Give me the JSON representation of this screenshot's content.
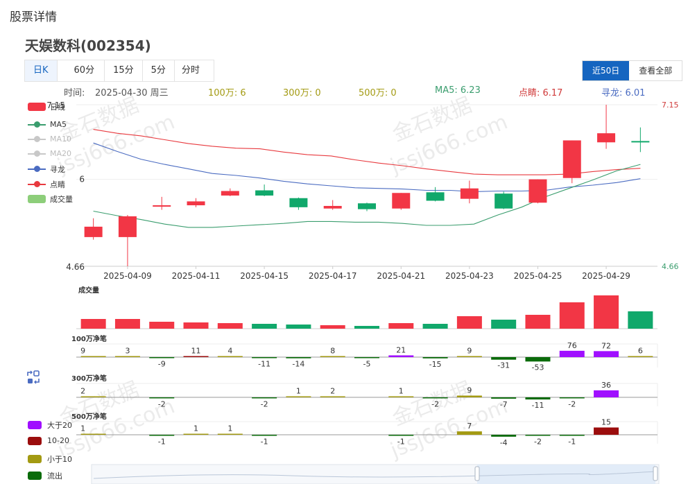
{
  "page_title": "股票详情",
  "stock_title": "天娱数科(002354)",
  "period_tabs": [
    "日K",
    "60分",
    "15分",
    "5分",
    "分时"
  ],
  "active_period": "日K",
  "range_tabs": [
    "近50日",
    "查看全部"
  ],
  "active_range": "近50日",
  "info": {
    "time_label": "时间:",
    "date": "2025-04-30 周三",
    "w100": "100万: 6",
    "w300": "300万: 0",
    "w500": "500万: 0",
    "ma5": "MA5: 6.23",
    "dianjing": "点睛: 6.17",
    "xunlong": "寻龙: 6.01"
  },
  "legend": [
    {
      "label": "日线",
      "type": "rect",
      "color": "#f23645"
    },
    {
      "label": "MA5",
      "type": "line",
      "color": "#3a9d6e"
    },
    {
      "label": "MA10",
      "type": "line",
      "color": "#c8c8c8"
    },
    {
      "label": "MA20",
      "type": "line",
      "color": "#c8c8c8"
    },
    {
      "label": "寻龙",
      "type": "line",
      "color": "#4a6bc1"
    },
    {
      "label": "点睛",
      "type": "line",
      "color": "#e8393e"
    },
    {
      "label": "成交量",
      "type": "rect",
      "color": "#8dce7a"
    }
  ],
  "flow_legend": [
    {
      "label": "大于20",
      "color": "#a00fff"
    },
    {
      "label": "10-20",
      "color": "#9b0d0d"
    },
    {
      "label": "小于10",
      "color": "#a39a12"
    },
    {
      "label": "流出",
      "color": "#0a6b0a"
    }
  ],
  "watermark": "金石数据 jssj666.com",
  "colors": {
    "up": "#f23645",
    "down": "#11a86b",
    "ma5": "#3a9d6e",
    "xunlong": "#4a6bc1",
    "dianjing": "#e8393e"
  },
  "chart_data": [
    {
      "type": "candlestick",
      "title": "",
      "ylim": [
        4.66,
        7.15
      ],
      "y_tick_labels": [
        "7.15",
        "6",
        "4.66"
      ],
      "right_tick_labels": [
        "7.15",
        "4.66"
      ],
      "x_tick_labels": [
        "2025-04-09",
        "2025-04-11",
        "2025-04-15",
        "2025-04-17",
        "2025-04-21",
        "2025-04-23",
        "2025-04-25",
        "2025-04-29"
      ],
      "candles": [
        {
          "open": 5.11,
          "close": 5.27,
          "high": 5.4,
          "low": 5.07,
          "dir": "up"
        },
        {
          "open": 5.11,
          "close": 5.43,
          "high": 5.45,
          "low": 4.66,
          "dir": "up"
        },
        {
          "open": 5.58,
          "close": 5.6,
          "high": 5.73,
          "low": 5.53,
          "dir": "up"
        },
        {
          "open": 5.6,
          "close": 5.66,
          "high": 5.71,
          "low": 5.57,
          "dir": "up"
        },
        {
          "open": 5.75,
          "close": 5.82,
          "high": 5.86,
          "low": 5.74,
          "dir": "up"
        },
        {
          "open": 5.83,
          "close": 5.75,
          "high": 5.92,
          "low": 5.74,
          "dir": "down"
        },
        {
          "open": 5.71,
          "close": 5.57,
          "high": 5.72,
          "low": 5.53,
          "dir": "down"
        },
        {
          "open": 5.55,
          "close": 5.59,
          "high": 5.68,
          "low": 5.53,
          "dir": "up"
        },
        {
          "open": 5.63,
          "close": 5.54,
          "high": 5.64,
          "low": 5.51,
          "dir": "down"
        },
        {
          "open": 5.55,
          "close": 5.79,
          "high": 5.79,
          "low": 5.53,
          "dir": "up"
        },
        {
          "open": 5.8,
          "close": 5.67,
          "high": 5.88,
          "low": 5.66,
          "dir": "down"
        },
        {
          "open": 5.7,
          "close": 5.86,
          "high": 5.98,
          "low": 5.63,
          "dir": "up"
        },
        {
          "open": 5.78,
          "close": 5.55,
          "high": 5.81,
          "low": 5.54,
          "dir": "down"
        },
        {
          "open": 5.64,
          "close": 6.0,
          "high": 6.0,
          "low": 5.63,
          "dir": "up"
        },
        {
          "open": 6.02,
          "close": 6.6,
          "high": 6.6,
          "low": 5.94,
          "dir": "up"
        },
        {
          "open": 6.57,
          "close": 6.71,
          "high": 7.15,
          "low": 6.47,
          "dir": "up"
        },
        {
          "open": 6.59,
          "close": 6.59,
          "high": 6.8,
          "low": 6.42,
          "dir": "down"
        }
      ],
      "ma5": [
        5.51,
        5.44,
        5.38,
        5.31,
        5.26,
        5.26,
        5.28,
        5.3,
        5.32,
        5.35,
        5.35,
        5.34,
        5.34,
        5.32,
        5.29,
        5.29,
        5.31,
        5.45,
        5.57,
        5.73,
        5.86,
        5.99,
        6.13,
        6.23
      ],
      "xunlong": [
        6.56,
        6.43,
        6.31,
        6.23,
        6.16,
        6.09,
        6.06,
        6.02,
        5.97,
        5.93,
        5.9,
        5.87,
        5.86,
        5.85,
        5.83,
        5.83,
        5.81,
        5.82,
        5.82,
        5.83,
        5.88,
        5.91,
        5.95,
        6.01
      ],
      "dianjing": [
        6.77,
        6.71,
        6.67,
        6.61,
        6.55,
        6.51,
        6.48,
        6.47,
        6.42,
        6.38,
        6.36,
        6.3,
        6.25,
        6.21,
        6.16,
        6.12,
        6.08,
        6.07,
        6.07,
        6.07,
        6.08,
        6.12,
        6.15,
        6.17
      ]
    },
    {
      "type": "bar",
      "title": "成交量",
      "values": [
        14,
        14,
        10,
        9,
        8,
        7,
        6,
        5,
        4,
        8,
        7,
        18,
        13,
        20,
        38,
        48,
        25
      ],
      "dirs": [
        "up",
        "up",
        "up",
        "up",
        "up",
        "down",
        "down",
        "up",
        "down",
        "up",
        "down",
        "up",
        "down",
        "up",
        "up",
        "up",
        "down"
      ]
    },
    {
      "type": "bar",
      "title": "100万净笔",
      "values": [
        9,
        3,
        -9,
        11,
        4,
        -11,
        -14,
        8,
        -5,
        21,
        -15,
        9,
        -31,
        -53,
        76,
        72,
        6
      ]
    },
    {
      "type": "bar",
      "title": "300万净笔",
      "values": [
        2,
        -2,
        -2,
        1,
        2,
        1,
        -2,
        9,
        -7,
        -11,
        -2,
        36
      ],
      "slots": [
        0,
        2,
        5,
        6,
        7,
        9,
        10,
        11,
        12,
        13,
        14,
        15
      ]
    },
    {
      "type": "bar",
      "title": "500万净笔",
      "values": [
        1,
        -1,
        1,
        1,
        -1,
        -1,
        7,
        -4,
        -2,
        -1,
        15
      ],
      "slots": [
        0,
        2,
        3,
        4,
        5,
        9,
        11,
        12,
        13,
        14,
        15
      ]
    }
  ]
}
